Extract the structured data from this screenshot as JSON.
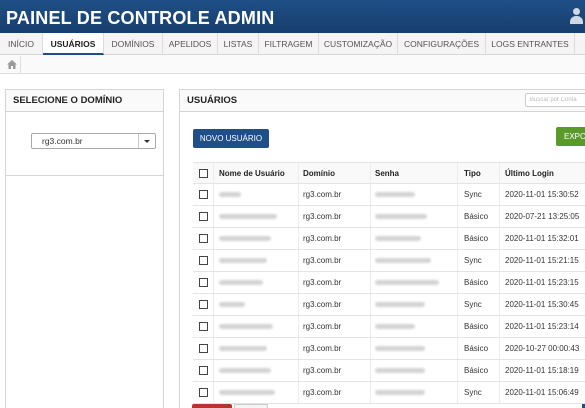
{
  "app": {
    "title": "PAINEL DE CONTROLE ADMIN"
  },
  "nav": {
    "items": [
      {
        "label": "INÍCIO"
      },
      {
        "label": "USUÁRIOS"
      },
      {
        "label": "DOMÍNIOS"
      },
      {
        "label": "APELIDOS"
      },
      {
        "label": "LISTAS"
      },
      {
        "label": "FILTRAGEM"
      },
      {
        "label": "CUSTOMIZAÇÃO"
      },
      {
        "label": "CONFIGURAÇÕES"
      },
      {
        "label": "LOGS ENTRANTES"
      }
    ],
    "active": "USUÁRIOS"
  },
  "domain_panel": {
    "title": "SELECIONE O DOMÍNIO",
    "selected_domain": "rg3.com.br"
  },
  "users_panel": {
    "title": "USUÁRIOS",
    "search_placeholder": "Buscar por Conta",
    "new_user_label": "NOVO USUÁRIO",
    "export_label": "EXPO"
  },
  "table": {
    "headers": [
      "Nome de Usuário",
      "Domínio",
      "Senha",
      "Tipo",
      "Último Login"
    ],
    "rows": [
      {
        "domain": "rg3.com.br",
        "type": "Sync",
        "last_login": "2020-11-01 15:30:52"
      },
      {
        "domain": "rg3.com.br",
        "type": "Básico",
        "last_login": "2020-07-21 13:25:05"
      },
      {
        "domain": "rg3.com.br",
        "type": "Básico",
        "last_login": "2020-11-01 15:32:01"
      },
      {
        "domain": "rg3.com.br",
        "type": "Sync",
        "last_login": "2020-11-01 15:21:15"
      },
      {
        "domain": "rg3.com.br",
        "type": "Básico",
        "last_login": "2020-11-01 15:23:15"
      },
      {
        "domain": "rg3.com.br",
        "type": "Sync",
        "last_login": "2020-11-01 15:30:45"
      },
      {
        "domain": "rg3.com.br",
        "type": "Básico",
        "last_login": "2020-11-01 15:23:14"
      },
      {
        "domain": "rg3.com.br",
        "type": "Básico",
        "last_login": "2020-10-27 00:00:43"
      },
      {
        "domain": "rg3.com.br",
        "type": "Básico",
        "last_login": "2020-11-01 15:18:19"
      },
      {
        "domain": "rg3.com.br",
        "type": "Sync",
        "last_login": "2020-11-01 15:06:49"
      }
    ]
  },
  "colors": {
    "brand": "#1f4f86",
    "export": "#5a9a2a",
    "danger": "#b83232"
  }
}
